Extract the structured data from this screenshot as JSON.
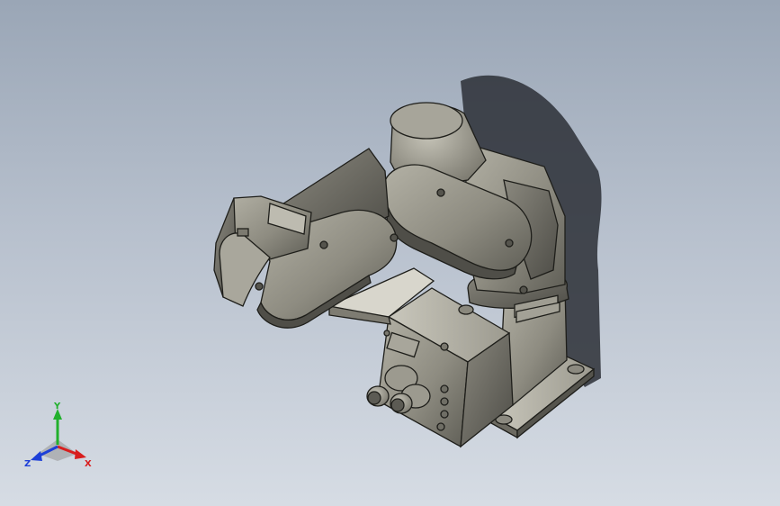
{
  "viewport": {
    "background_top": "#9aa6b6",
    "background_bottom": "#d6dce4",
    "model_color": "#8d8b80",
    "model_edge_color": "#1e1e1a",
    "shadow_color": "#2c2f36"
  },
  "triad": {
    "x_label": "X",
    "y_label": "Y",
    "z_label": "Z",
    "x_color": "#d81e1e",
    "y_color": "#21b02c",
    "z_color": "#1d3fd8"
  }
}
